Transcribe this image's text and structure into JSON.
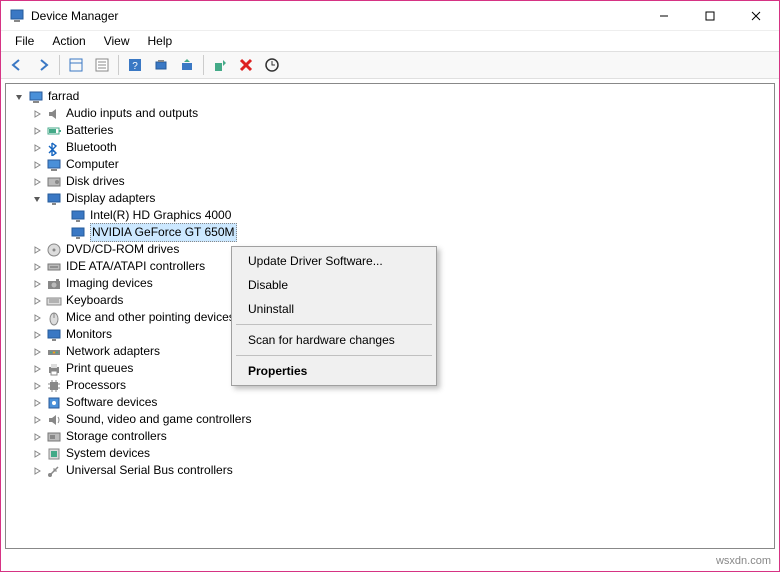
{
  "titlebar": {
    "title": "Device Manager"
  },
  "menubar": {
    "items": [
      "File",
      "Action",
      "View",
      "Help"
    ]
  },
  "tree": {
    "root": "farrad",
    "nodes": [
      {
        "label": "Audio inputs and outputs",
        "expanded": false,
        "selected": false,
        "icon": "audio"
      },
      {
        "label": "Batteries",
        "expanded": false,
        "selected": false,
        "icon": "battery"
      },
      {
        "label": "Bluetooth",
        "expanded": false,
        "selected": false,
        "icon": "bluetooth"
      },
      {
        "label": "Computer",
        "expanded": false,
        "selected": false,
        "icon": "computer"
      },
      {
        "label": "Disk drives",
        "expanded": false,
        "selected": false,
        "icon": "disk"
      },
      {
        "label": "Display adapters",
        "expanded": true,
        "selected": false,
        "icon": "display",
        "children": [
          {
            "label": "Intel(R) HD Graphics 4000",
            "selected": false,
            "icon": "display"
          },
          {
            "label": "NVIDIA GeForce GT 650M",
            "selected": true,
            "icon": "display"
          }
        ]
      },
      {
        "label": "DVD/CD-ROM drives",
        "expanded": false,
        "selected": false,
        "icon": "dvd"
      },
      {
        "label": "IDE ATA/ATAPI controllers",
        "expanded": false,
        "selected": false,
        "icon": "ide"
      },
      {
        "label": "Imaging devices",
        "expanded": false,
        "selected": false,
        "icon": "imaging"
      },
      {
        "label": "Keyboards",
        "expanded": false,
        "selected": false,
        "icon": "keyboard"
      },
      {
        "label": "Mice and other pointing devices",
        "expanded": false,
        "selected": false,
        "icon": "mouse"
      },
      {
        "label": "Monitors",
        "expanded": false,
        "selected": false,
        "icon": "monitor"
      },
      {
        "label": "Network adapters",
        "expanded": false,
        "selected": false,
        "icon": "network"
      },
      {
        "label": "Print queues",
        "expanded": false,
        "selected": false,
        "icon": "printer"
      },
      {
        "label": "Processors",
        "expanded": false,
        "selected": false,
        "icon": "processor"
      },
      {
        "label": "Software devices",
        "expanded": false,
        "selected": false,
        "icon": "software"
      },
      {
        "label": "Sound, video and game controllers",
        "expanded": false,
        "selected": false,
        "icon": "sound"
      },
      {
        "label": "Storage controllers",
        "expanded": false,
        "selected": false,
        "icon": "storage"
      },
      {
        "label": "System devices",
        "expanded": false,
        "selected": false,
        "icon": "system"
      },
      {
        "label": "Universal Serial Bus controllers",
        "expanded": false,
        "selected": false,
        "icon": "usb"
      }
    ]
  },
  "context_menu": {
    "items": [
      {
        "label": "Update Driver Software...",
        "bold": false
      },
      {
        "label": "Disable",
        "bold": false
      },
      {
        "label": "Uninstall",
        "bold": false
      },
      {
        "sep": true
      },
      {
        "label": "Scan for hardware changes",
        "bold": false
      },
      {
        "sep": true
      },
      {
        "label": "Properties",
        "bold": true
      }
    ]
  },
  "watermark": "wsxdn.com"
}
